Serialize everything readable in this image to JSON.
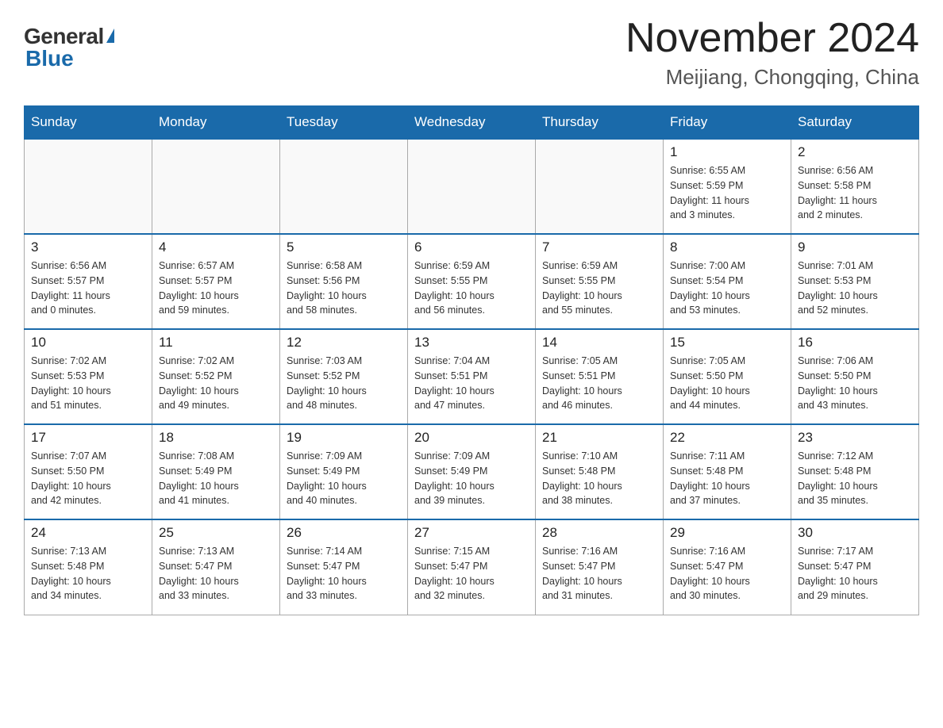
{
  "header": {
    "logo_general": "General",
    "logo_blue": "Blue",
    "month_title": "November 2024",
    "location": "Meijiang, Chongqing, China"
  },
  "days_of_week": [
    "Sunday",
    "Monday",
    "Tuesday",
    "Wednesday",
    "Thursday",
    "Friday",
    "Saturday"
  ],
  "weeks": [
    [
      {
        "day": "",
        "info": ""
      },
      {
        "day": "",
        "info": ""
      },
      {
        "day": "",
        "info": ""
      },
      {
        "day": "",
        "info": ""
      },
      {
        "day": "",
        "info": ""
      },
      {
        "day": "1",
        "info": "Sunrise: 6:55 AM\nSunset: 5:59 PM\nDaylight: 11 hours\nand 3 minutes."
      },
      {
        "day": "2",
        "info": "Sunrise: 6:56 AM\nSunset: 5:58 PM\nDaylight: 11 hours\nand 2 minutes."
      }
    ],
    [
      {
        "day": "3",
        "info": "Sunrise: 6:56 AM\nSunset: 5:57 PM\nDaylight: 11 hours\nand 0 minutes."
      },
      {
        "day": "4",
        "info": "Sunrise: 6:57 AM\nSunset: 5:57 PM\nDaylight: 10 hours\nand 59 minutes."
      },
      {
        "day": "5",
        "info": "Sunrise: 6:58 AM\nSunset: 5:56 PM\nDaylight: 10 hours\nand 58 minutes."
      },
      {
        "day": "6",
        "info": "Sunrise: 6:59 AM\nSunset: 5:55 PM\nDaylight: 10 hours\nand 56 minutes."
      },
      {
        "day": "7",
        "info": "Sunrise: 6:59 AM\nSunset: 5:55 PM\nDaylight: 10 hours\nand 55 minutes."
      },
      {
        "day": "8",
        "info": "Sunrise: 7:00 AM\nSunset: 5:54 PM\nDaylight: 10 hours\nand 53 minutes."
      },
      {
        "day": "9",
        "info": "Sunrise: 7:01 AM\nSunset: 5:53 PM\nDaylight: 10 hours\nand 52 minutes."
      }
    ],
    [
      {
        "day": "10",
        "info": "Sunrise: 7:02 AM\nSunset: 5:53 PM\nDaylight: 10 hours\nand 51 minutes."
      },
      {
        "day": "11",
        "info": "Sunrise: 7:02 AM\nSunset: 5:52 PM\nDaylight: 10 hours\nand 49 minutes."
      },
      {
        "day": "12",
        "info": "Sunrise: 7:03 AM\nSunset: 5:52 PM\nDaylight: 10 hours\nand 48 minutes."
      },
      {
        "day": "13",
        "info": "Sunrise: 7:04 AM\nSunset: 5:51 PM\nDaylight: 10 hours\nand 47 minutes."
      },
      {
        "day": "14",
        "info": "Sunrise: 7:05 AM\nSunset: 5:51 PM\nDaylight: 10 hours\nand 46 minutes."
      },
      {
        "day": "15",
        "info": "Sunrise: 7:05 AM\nSunset: 5:50 PM\nDaylight: 10 hours\nand 44 minutes."
      },
      {
        "day": "16",
        "info": "Sunrise: 7:06 AM\nSunset: 5:50 PM\nDaylight: 10 hours\nand 43 minutes."
      }
    ],
    [
      {
        "day": "17",
        "info": "Sunrise: 7:07 AM\nSunset: 5:50 PM\nDaylight: 10 hours\nand 42 minutes."
      },
      {
        "day": "18",
        "info": "Sunrise: 7:08 AM\nSunset: 5:49 PM\nDaylight: 10 hours\nand 41 minutes."
      },
      {
        "day": "19",
        "info": "Sunrise: 7:09 AM\nSunset: 5:49 PM\nDaylight: 10 hours\nand 40 minutes."
      },
      {
        "day": "20",
        "info": "Sunrise: 7:09 AM\nSunset: 5:49 PM\nDaylight: 10 hours\nand 39 minutes."
      },
      {
        "day": "21",
        "info": "Sunrise: 7:10 AM\nSunset: 5:48 PM\nDaylight: 10 hours\nand 38 minutes."
      },
      {
        "day": "22",
        "info": "Sunrise: 7:11 AM\nSunset: 5:48 PM\nDaylight: 10 hours\nand 37 minutes."
      },
      {
        "day": "23",
        "info": "Sunrise: 7:12 AM\nSunset: 5:48 PM\nDaylight: 10 hours\nand 35 minutes."
      }
    ],
    [
      {
        "day": "24",
        "info": "Sunrise: 7:13 AM\nSunset: 5:48 PM\nDaylight: 10 hours\nand 34 minutes."
      },
      {
        "day": "25",
        "info": "Sunrise: 7:13 AM\nSunset: 5:47 PM\nDaylight: 10 hours\nand 33 minutes."
      },
      {
        "day": "26",
        "info": "Sunrise: 7:14 AM\nSunset: 5:47 PM\nDaylight: 10 hours\nand 33 minutes."
      },
      {
        "day": "27",
        "info": "Sunrise: 7:15 AM\nSunset: 5:47 PM\nDaylight: 10 hours\nand 32 minutes."
      },
      {
        "day": "28",
        "info": "Sunrise: 7:16 AM\nSunset: 5:47 PM\nDaylight: 10 hours\nand 31 minutes."
      },
      {
        "day": "29",
        "info": "Sunrise: 7:16 AM\nSunset: 5:47 PM\nDaylight: 10 hours\nand 30 minutes."
      },
      {
        "day": "30",
        "info": "Sunrise: 7:17 AM\nSunset: 5:47 PM\nDaylight: 10 hours\nand 29 minutes."
      }
    ]
  ]
}
